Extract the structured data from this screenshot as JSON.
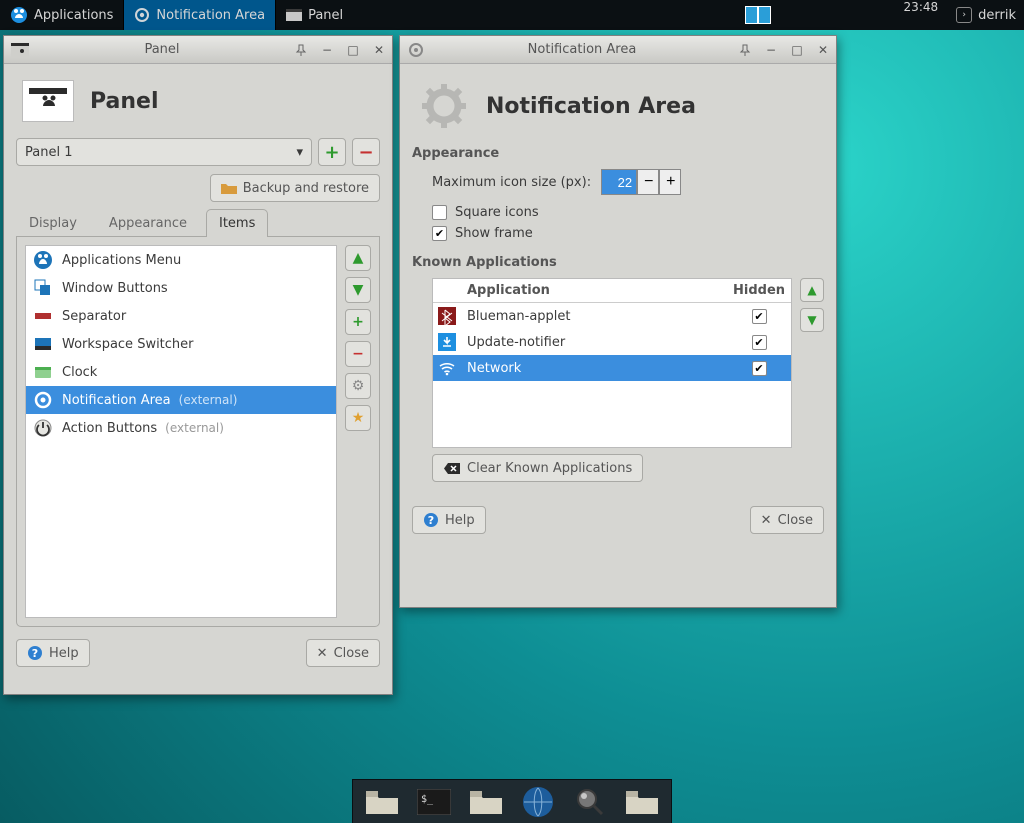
{
  "taskbar": {
    "start_label": "Applications",
    "windows": [
      {
        "label": "Notification Area",
        "selected": true,
        "icon": "gear"
      },
      {
        "label": "Panel",
        "selected": false,
        "icon": "panel"
      }
    ],
    "clock": "23:48",
    "user": "derrik"
  },
  "panelWindow": {
    "title": "Panel",
    "headerTitle": "Panel",
    "comboValue": "Panel 1",
    "backupLabel": "Backup and restore",
    "tabs": [
      "Display",
      "Appearance",
      "Items"
    ],
    "activeTab": 2,
    "items": [
      {
        "label": "Applications Menu",
        "icon": "app-menu",
        "ext": ""
      },
      {
        "label": "Window Buttons",
        "icon": "windows",
        "ext": ""
      },
      {
        "label": "Separator",
        "icon": "separator",
        "ext": ""
      },
      {
        "label": "Workspace Switcher",
        "icon": "workspace",
        "ext": ""
      },
      {
        "label": "Clock",
        "icon": "clock",
        "ext": ""
      },
      {
        "label": "Notification Area",
        "icon": "gear",
        "ext": "(external)",
        "selected": true
      },
      {
        "label": "Action Buttons",
        "icon": "power",
        "ext": "(external)"
      }
    ],
    "helpLabel": "Help",
    "closeLabel": "Close"
  },
  "notifWindow": {
    "title": "Notification Area",
    "headerTitle": "Notification Area",
    "appearanceLabel": "Appearance",
    "maxIconLabel": "Maximum icon size (px):",
    "maxIconValue": "22",
    "squareLabel": "Square icons",
    "squareChecked": false,
    "frameLabel": "Show frame",
    "frameChecked": true,
    "knownLabel": "Known Applications",
    "colApp": "Application",
    "colHidden": "Hidden",
    "apps": [
      {
        "name": "Blueman-applet",
        "icon": "bluetooth",
        "hidden": true
      },
      {
        "name": "Update-notifier",
        "icon": "update",
        "hidden": true
      },
      {
        "name": "Network",
        "icon": "wifi",
        "hidden": true,
        "selected": true
      }
    ],
    "clearLabel": "Clear Known Applications",
    "helpLabel": "Help",
    "closeLabel": "Close"
  }
}
